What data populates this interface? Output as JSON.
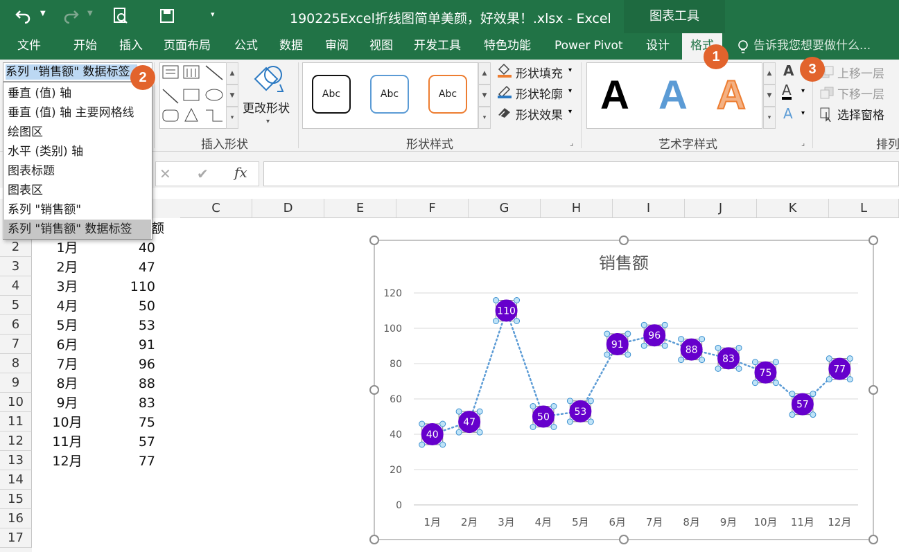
{
  "window": {
    "title": "190225Excel折线图简单美颜，好效果！.xlsx - Excel",
    "context_tab": "图表工具"
  },
  "ribbon_tabs": [
    "文件",
    "开始",
    "插入",
    "页面布局",
    "公式",
    "数据",
    "审阅",
    "视图",
    "开发工具",
    "特色功能",
    "Power Pivot",
    "设计",
    "格式"
  ],
  "active_tab": "格式",
  "tell_me": "告诉我您想要做什么...",
  "namebox": {
    "value": "系列 \"销售额\" 数据标签"
  },
  "dropdown_items": [
    "垂直 (值) 轴",
    "垂直 (值) 轴 主要网格线",
    "绘图区",
    "水平 (类别) 轴",
    "图表标题",
    "图表区",
    "系列 \"销售额\"",
    "系列 \"销售额\" 数据标签"
  ],
  "groups": {
    "insert_shapes": "插入形状",
    "shape_styles": "形状样式",
    "wordart": "艺术字样式",
    "arrange": "排列"
  },
  "buttons": {
    "change_shape": "更改形状",
    "fill": "形状填充",
    "outline": "形状轮廓",
    "effect": "形状效果",
    "bring_forward": "上移一层",
    "send_backward": "下移一层",
    "selection_pane": "选择窗格"
  },
  "style_samples": [
    "Abc",
    "Abc",
    "Abc"
  ],
  "wordart_samples": [
    "A",
    "A",
    "A"
  ],
  "formula_bar": {
    "fx": "fx",
    "cancel": "✕",
    "enter": "✔"
  },
  "columns": [
    "C",
    "D",
    "E",
    "F",
    "G",
    "H",
    "I",
    "J",
    "K",
    "L"
  ],
  "rows": [
    "2",
    "3",
    "4",
    "5",
    "6",
    "7",
    "8",
    "9",
    "10",
    "11",
    "12",
    "13",
    "14",
    "15",
    "16",
    "17"
  ],
  "header_partial": "额",
  "table": [
    {
      "month": "1月",
      "value": "40"
    },
    {
      "month": "2月",
      "value": "47"
    },
    {
      "month": "3月",
      "value": "110"
    },
    {
      "month": "4月",
      "value": "50"
    },
    {
      "month": "5月",
      "value": "53"
    },
    {
      "month": "6月",
      "value": "91"
    },
    {
      "month": "7月",
      "value": "96"
    },
    {
      "month": "8月",
      "value": "88"
    },
    {
      "month": "9月",
      "value": "83"
    },
    {
      "month": "10月",
      "value": "75"
    },
    {
      "month": "11月",
      "value": "57"
    },
    {
      "month": "12月",
      "value": "77"
    }
  ],
  "badges": [
    "1",
    "2",
    "3"
  ],
  "chart_data": {
    "type": "line",
    "title": "销售额",
    "categories": [
      "1月",
      "2月",
      "3月",
      "4月",
      "5月",
      "6月",
      "7月",
      "8月",
      "9月",
      "10月",
      "11月",
      "12月"
    ],
    "series": [
      {
        "values": [
          40,
          47,
          110,
          50,
          53,
          91,
          96,
          88,
          83,
          75,
          57,
          77
        ],
        "line_color": "#5B9BD5",
        "line_style": "dotted",
        "marker_color": "#6600CC",
        "label_color": "#ffffff"
      }
    ],
    "ylim": [
      0,
      120
    ],
    "yticks": [
      0,
      20,
      40,
      60,
      80,
      100,
      120
    ],
    "grid": true,
    "legend": "none"
  }
}
